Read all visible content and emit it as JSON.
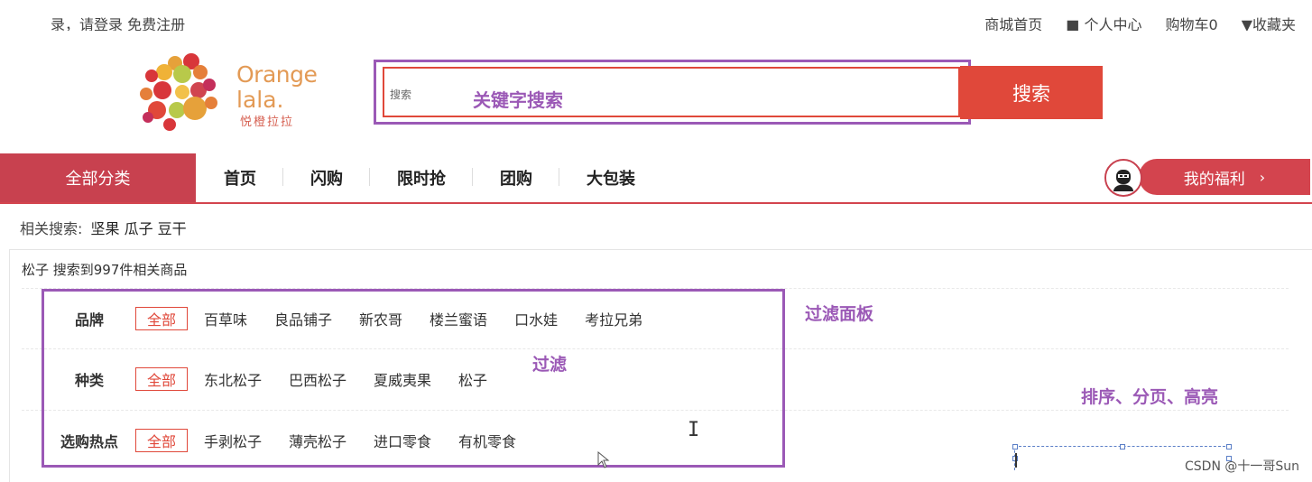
{
  "topbar": {
    "left_text": "录，请登录 免费注册",
    "links": [
      "商城首页",
      "■ 个人中心",
      "购物车0",
      "▼收藏夹"
    ]
  },
  "logo": {
    "line1": "Orange",
    "line2": "lala.",
    "line3": "悦橙拉拉"
  },
  "search": {
    "placeholder": "搜索",
    "annotation": "关键字搜索",
    "button_label": "搜索"
  },
  "nav": {
    "all_categories": "全部分类",
    "items": [
      "首页",
      "闪购",
      "限时抢",
      "团购",
      "大包装"
    ],
    "welfare_label": "我的福利",
    "welfare_chevron": "›"
  },
  "related": {
    "label": "相关搜索:",
    "keywords": "坚果 瓜子 豆干"
  },
  "results": {
    "count_text": "松子 搜索到997件相关商品"
  },
  "filters": [
    {
      "label": "品牌",
      "all": "全部",
      "options": [
        "百草味",
        "良品铺子",
        "新农哥",
        "楼兰蜜语",
        "口水娃",
        "考拉兄弟"
      ]
    },
    {
      "label": "种类",
      "all": "全部",
      "options": [
        "东北松子",
        "巴西松子",
        "夏威夷果",
        "松子"
      ]
    },
    {
      "label": "选购热点",
      "all": "全部",
      "options": [
        "手剥松子",
        "薄壳松子",
        "进口零食",
        "有机零食"
      ]
    }
  ],
  "annotations": {
    "filter_panel": "过滤面板",
    "filter": "过滤",
    "sort_page_highlight": "排序、分页、高亮"
  },
  "watermark": "CSDN @十一哥Sun",
  "colors": {
    "accent_red": "#e0483a",
    "nav_red": "#c8414f",
    "annotation_purple": "#9b59b6",
    "logo_orange": "#e39a55"
  }
}
